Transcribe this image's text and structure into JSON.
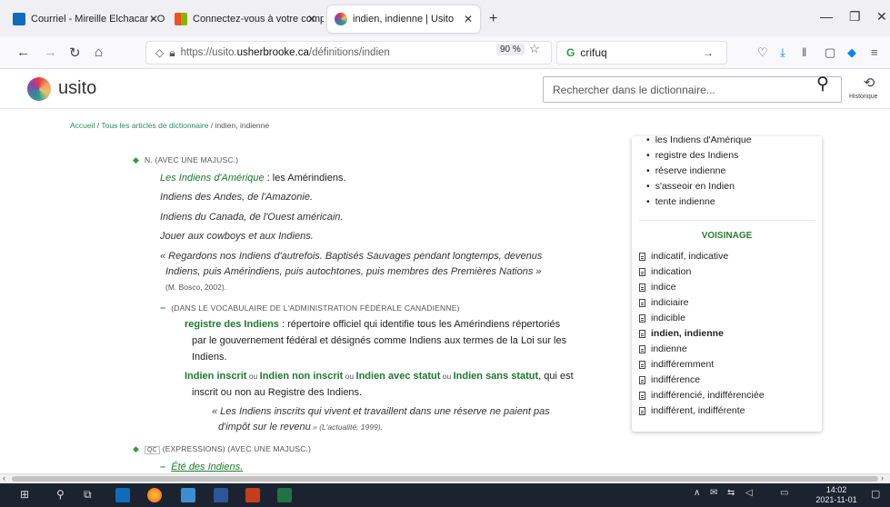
{
  "browser": {
    "tabs": [
      {
        "label": "Courriel - Mireille Elchacar - Ou",
        "color": "#0f6cbd"
      },
      {
        "label": "Connectez-vous à votre compte",
        "color": "#f25022"
      },
      {
        "label": "indien, indienne | Usito",
        "color": "#e63946"
      }
    ],
    "url_prefix": "https://usito.",
    "url_domain": "usherbrooke.ca",
    "url_path": "/définitions/indien",
    "zoom": "90 %",
    "search_text": "crifuq"
  },
  "site": {
    "logo_text": "usito",
    "search_placeholder": "Rechercher dans le dictionnaire...",
    "history_label": "Historique"
  },
  "breadcrumb": {
    "home": "Accueil",
    "sep": " / ",
    "all": "Tous les articles de dictionnaire",
    "current": "indien, indienne"
  },
  "entry": {
    "sense_label": "N. (AVEC UNE MAJUSC.)",
    "ex1_term": "Les Indiens d'Amérique",
    "ex1_def": " : les Amérindiens.",
    "ex2": "Indiens des Andes, de l'Amazonie.",
    "ex3": "Indiens du Canada, de l'Ouest américain.",
    "ex4": "Jouer aux cowboys et aux Indiens.",
    "quote1_line1": "« Regardons nos Indiens d'autrefois. Baptisés Sauvages pendant longtemps, devenus",
    "quote1_line2": "Indiens, puis Amérindiens, puis autochtones, puis membres des Premières Nations »",
    "quote1_src": "(M. Bosco, 2002).",
    "subsense_label": "(DANS LE VOCABULAIRE DE L'ADMINISTRATION FÉDÉRALE CANADIENNE)",
    "term1": "registre des Indiens",
    "term1_def_line1": " : répertoire officiel qui identifie tous les Amérindiens répertoriés",
    "term1_def_line2": "par le gouvernement fédéral et désignés comme Indiens aux termes de la Loi sur les",
    "term1_def_line3": "Indiens.",
    "t2a": "Indien inscrit",
    "ou1": " ou ",
    "t2b": "Indien non inscrit",
    "ou2": " ou ",
    "t2c": "Indien avec statut",
    "ou3": " ou ",
    "t2d": "Indien sans statut",
    "t2_rest": ", qui est",
    "t2_line2": "inscrit ou non au Registre des Indiens.",
    "quote2_line1": "« Les Indiens inscrits qui vivent et travaillent dans une réserve ne paient pas",
    "quote2_line2": "d'impôt sur le revenu",
    "quote2_src": " » (L'actualité, 1999).",
    "qc_label": "QC",
    "expr_label": "(EXPRESSIONS) (AVEC UNE MAJUSC.)",
    "expr1": "Été des Indiens."
  },
  "sidebar": {
    "related": [
      "les Indiens d'Amérique",
      "registre des Indiens",
      "réserve indienne",
      "s'asseoir en Indien",
      "tente indienne"
    ],
    "voisinage_title": "VOISINAGE",
    "voisinage": [
      "indicatif, indicative",
      "indication",
      "indice",
      "indiciaire",
      "indicible",
      "indien, indienne",
      "indienne",
      "indifféremment",
      "indifférence",
      "indifférencié, indifférenciée",
      "indifférent, indifférente"
    ]
  },
  "taskbar": {
    "time": "14:02",
    "date": "2021-11-01"
  }
}
